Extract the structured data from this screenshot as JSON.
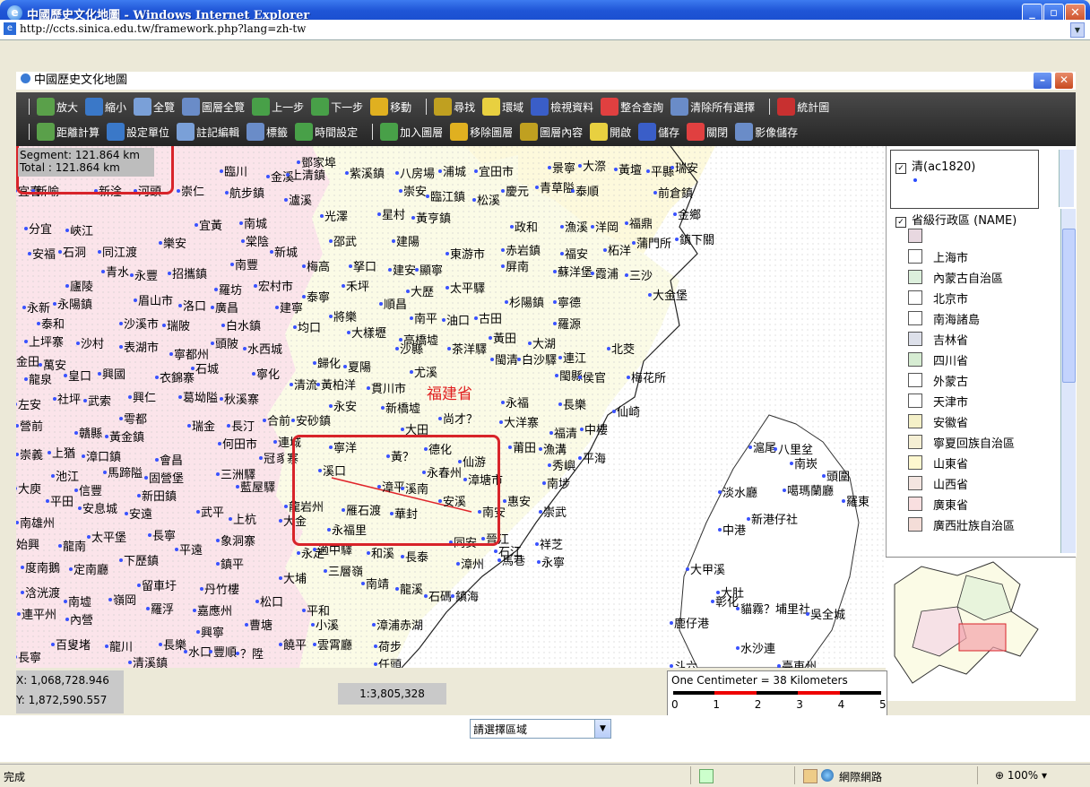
{
  "window": {
    "title": "中國歷史文化地圖 - Windows Internet Explorer",
    "url": "http://ccts.sinica.edu.tw/framework.php?lang=zh-tw",
    "inner_title": "中國歷史文化地圖"
  },
  "toolbar": {
    "row1": [
      "放大",
      "縮小",
      "全覽",
      "圖層全覽",
      "上一步",
      "下一步",
      "移動",
      "尋找",
      "環域",
      "檢視資料",
      "整合查詢",
      "清除所有選擇",
      "統計圖"
    ],
    "row2": [
      "距離計算",
      "設定單位",
      "註記編輯",
      "標籤",
      "時間設定",
      "加入圖層",
      "移除圖層",
      "圖層內容",
      "開啟",
      "儲存",
      "關閉",
      "影像儲存"
    ]
  },
  "measure": {
    "segment": "Segment: 121.864 km",
    "total": "Total : 121.864 km"
  },
  "map": {
    "province_label": "福建省",
    "places": [
      [
        "臨川",
        232,
        18
      ],
      [
        "金溪",
        284,
        24
      ],
      [
        "上清鎮",
        306,
        22
      ],
      [
        "鄧家埠",
        318,
        8
      ],
      [
        "紫溪鎮",
        372,
        20
      ],
      [
        "八房場",
        428,
        20
      ],
      [
        "浦城",
        476,
        18
      ],
      [
        "宜田市",
        516,
        18
      ],
      [
        "景寧",
        598,
        14
      ],
      [
        "大漈",
        632,
        12
      ],
      [
        "黃壇",
        672,
        16
      ],
      [
        "平縣",
        708,
        18
      ],
      [
        "瑞安",
        735,
        14
      ],
      [
        "宜春",
        2,
        40
      ],
      [
        "新喻",
        22,
        40
      ],
      [
        "新淦",
        92,
        40
      ],
      [
        "河頭",
        136,
        40
      ],
      [
        "崇仁",
        184,
        40
      ],
      [
        "航步鎮",
        238,
        42
      ],
      [
        "瀘溪",
        304,
        50
      ],
      [
        "崇安",
        432,
        40
      ],
      [
        "臨江鎮",
        462,
        46
      ],
      [
        "松溪",
        514,
        50
      ],
      [
        "慶元",
        546,
        40
      ],
      [
        "青草隘",
        584,
        36
      ],
      [
        "泰順",
        624,
        40
      ],
      [
        "前倉鎮",
        716,
        42
      ],
      [
        "分宜",
        14,
        82
      ],
      [
        "峽江",
        60,
        84
      ],
      [
        "宜黃",
        204,
        78
      ],
      [
        "南城",
        254,
        76
      ],
      [
        "光澤",
        344,
        68
      ],
      [
        "星村",
        408,
        66
      ],
      [
        "黃亨鎮",
        446,
        70
      ],
      [
        "政和",
        556,
        80
      ],
      [
        "漁溪",
        612,
        80
      ],
      [
        "洋岡",
        646,
        80
      ],
      [
        "福鼎",
        684,
        76
      ],
      [
        "金鄉",
        738,
        66
      ],
      [
        "安福",
        18,
        110
      ],
      [
        "石洞",
        52,
        108
      ],
      [
        "同江渡",
        96,
        108
      ],
      [
        "樂安",
        164,
        98
      ],
      [
        "棠陰",
        256,
        96
      ],
      [
        "新城",
        288,
        108
      ],
      [
        "邵武",
        354,
        96
      ],
      [
        "建陽",
        424,
        96
      ],
      [
        "東游市",
        484,
        110
      ],
      [
        "赤岩鎮",
        546,
        106
      ],
      [
        "福安",
        612,
        110
      ],
      [
        "柘洋",
        660,
        106
      ],
      [
        "蒲門所",
        692,
        98
      ],
      [
        "鎮下關",
        740,
        94
      ],
      [
        "廬陵",
        60,
        146
      ],
      [
        "青水",
        100,
        130
      ],
      [
        "永豐",
        132,
        134
      ],
      [
        "招攜鎮",
        174,
        132
      ],
      [
        "南豐",
        244,
        122
      ],
      [
        "羅坊",
        226,
        150
      ],
      [
        "宏村市",
        270,
        146
      ],
      [
        "梅高",
        324,
        124
      ],
      [
        "拏口",
        376,
        124
      ],
      [
        "禾坪",
        368,
        146
      ],
      [
        "建安",
        420,
        128
      ],
      [
        "顯寧",
        450,
        128
      ],
      [
        "太平驛",
        484,
        148
      ],
      [
        "屏南",
        546,
        124
      ],
      [
        "蘇洋堡",
        604,
        130
      ],
      [
        "霞浦",
        646,
        132
      ],
      [
        "三沙",
        684,
        134
      ],
      [
        "永新",
        12,
        170
      ],
      [
        "永陽鎮",
        46,
        166
      ],
      [
        "眉山市",
        136,
        162
      ],
      [
        "洛口",
        186,
        168
      ],
      [
        "廣昌",
        222,
        170
      ],
      [
        "建寧",
        294,
        170
      ],
      [
        "泰寧",
        324,
        158
      ],
      [
        "順昌",
        410,
        166
      ],
      [
        "大歷",
        440,
        152
      ],
      [
        "杉陽鎮",
        550,
        164
      ],
      [
        "寧德",
        604,
        164
      ],
      [
        "大金堡",
        710,
        156
      ],
      [
        "泰和",
        28,
        188
      ],
      [
        "沙溪市",
        120,
        188
      ],
      [
        "瑞陂",
        168,
        190
      ],
      [
        "將樂",
        354,
        180
      ],
      [
        "白水鎮",
        234,
        190
      ],
      [
        "均口",
        314,
        192
      ],
      [
        "南平",
        444,
        182
      ],
      [
        "油口",
        480,
        184
      ],
      [
        "古田",
        516,
        182
      ],
      [
        "羅源",
        604,
        188
      ],
      [
        "上坪寨",
        14,
        208
      ],
      [
        "沙村",
        72,
        210
      ],
      [
        "表湖市",
        120,
        214
      ],
      [
        "頭陂",
        222,
        210
      ],
      [
        "水西城",
        258,
        216
      ],
      [
        "大樣壢",
        374,
        198
      ],
      [
        "沙縣",
        428,
        216
      ],
      [
        "高橋墟",
        432,
        206
      ],
      [
        "茶洋驛",
        486,
        216
      ],
      [
        "黃田",
        532,
        204
      ],
      [
        "大湖",
        576,
        210
      ],
      [
        "北茭",
        664,
        216
      ],
      [
        "金田",
        0,
        230
      ],
      [
        "萬安",
        30,
        234
      ],
      [
        "寧都州",
        176,
        222
      ],
      [
        "閩清",
        534,
        228
      ],
      [
        "白沙驛",
        564,
        228
      ],
      [
        "連江",
        610,
        226
      ],
      [
        "龍泉",
        14,
        250
      ],
      [
        "皇口",
        58,
        246
      ],
      [
        "興國",
        96,
        244
      ],
      [
        "衣錦寨",
        160,
        248
      ],
      [
        "石城",
        200,
        238
      ],
      [
        "寧化",
        268,
        244
      ],
      [
        "歸化",
        336,
        232
      ],
      [
        "夏陽",
        370,
        236
      ],
      [
        "尤溪",
        444,
        242
      ],
      [
        "閩縣",
        606,
        246
      ],
      [
        "侯官",
        632,
        248
      ],
      [
        "梅花所",
        686,
        248
      ],
      [
        "左安",
        2,
        278
      ],
      [
        "社坪",
        46,
        272
      ],
      [
        "武索",
        80,
        274
      ],
      [
        "興仁",
        130,
        270
      ],
      [
        "葛坳隘",
        186,
        270
      ],
      [
        "秋溪寨",
        232,
        272
      ],
      [
        "清流",
        310,
        256
      ],
      [
        "黃柏洋",
        340,
        256
      ],
      [
        "貫川市",
        396,
        260
      ],
      [
        "永安",
        354,
        280
      ],
      [
        "新橋墟",
        412,
        282
      ],
      [
        "永福",
        546,
        276
      ],
      [
        "長樂",
        610,
        278
      ],
      [
        "仙崎",
        670,
        286
      ],
      [
        "營前",
        4,
        302
      ],
      [
        "雩都",
        120,
        294
      ],
      [
        "瑞金",
        196,
        302
      ],
      [
        "長汀",
        240,
        302
      ],
      [
        "合前",
        280,
        296
      ],
      [
        "安砂鎮",
        312,
        296
      ],
      [
        "大田",
        434,
        306
      ],
      [
        "尚才？",
        476,
        294
      ],
      [
        "大洋寨",
        544,
        298
      ],
      [
        "福清",
        600,
        310
      ],
      [
        "中樓",
        634,
        306
      ],
      [
        "崇義",
        4,
        334
      ],
      [
        "上猶",
        40,
        332
      ],
      [
        "贛縣",
        70,
        310
      ],
      [
        "黃金鎮",
        104,
        314
      ],
      [
        "漳口鎮",
        78,
        336
      ],
      [
        "會昌",
        160,
        340
      ],
      [
        "何田市",
        230,
        322
      ],
      [
        "連城",
        292,
        320
      ],
      [
        "冠豸寨",
        276,
        338
      ],
      [
        "寧洋",
        354,
        326
      ],
      [
        "德化",
        460,
        328
      ],
      [
        "仙游",
        498,
        342
      ],
      [
        "莆田",
        554,
        326
      ],
      [
        "漁溝",
        588,
        328
      ],
      [
        "池江",
        44,
        358
      ],
      [
        "馬蹄隘",
        102,
        354
      ],
      [
        "固營堡",
        148,
        360
      ],
      [
        "三洲驛",
        228,
        356
      ],
      [
        "溪口",
        342,
        352
      ],
      [
        "黃？",
        418,
        336
      ],
      [
        "永春州",
        458,
        354
      ],
      [
        "漳塘市",
        504,
        362
      ],
      [
        "秀嶼",
        598,
        346
      ],
      [
        "平海",
        632,
        338
      ],
      [
        "大庾",
        2,
        372
      ],
      [
        "信豐",
        70,
        374
      ],
      [
        "新田鎮",
        140,
        380
      ],
      [
        "藍屋驛",
        250,
        370
      ],
      [
        "漳平",
        408,
        370
      ],
      [
        "溪南",
        434,
        372
      ],
      [
        "南埗",
        592,
        366
      ],
      [
        "平田",
        38,
        386
      ],
      [
        "安息城",
        74,
        394
      ],
      [
        "安遠",
        126,
        400
      ],
      [
        "龍岩州",
        304,
        392
      ],
      [
        "雁石渡",
        368,
        396
      ],
      [
        "安溪",
        476,
        386
      ],
      [
        "南安",
        520,
        398
      ],
      [
        "惠安",
        548,
        386
      ],
      [
        "崇武",
        588,
        398
      ],
      [
        "南雄州",
        4,
        410
      ],
      [
        "太平堡",
        84,
        426
      ],
      [
        "長寧",
        152,
        424
      ],
      [
        "武平",
        206,
        398
      ],
      [
        "上杭",
        242,
        406
      ],
      [
        "大金",
        298,
        408
      ],
      [
        "永福里",
        352,
        418
      ],
      [
        "華封",
        422,
        400
      ],
      [
        "晉江",
        524,
        428
      ],
      [
        "始興",
        0,
        434
      ],
      [
        "龍南",
        52,
        436
      ],
      [
        "象洞寨",
        228,
        430
      ],
      [
        "平遠",
        182,
        440
      ],
      [
        "永定",
        318,
        444
      ],
      [
        "適中驛",
        336,
        440
      ],
      [
        "和溪",
        396,
        444
      ],
      [
        "長泰",
        434,
        448
      ],
      [
        "同安",
        488,
        432
      ],
      [
        "石江",
        538,
        442
      ],
      [
        "祥芝",
        584,
        434
      ],
      [
        "度南鵝",
        10,
        460
      ],
      [
        "定南廳",
        64,
        462
      ],
      [
        "下歷鎮",
        120,
        452
      ],
      [
        "鎮平",
        228,
        456
      ],
      [
        "三層嶺",
        348,
        464
      ],
      [
        "漳州",
        496,
        456
      ],
      [
        "馬巷",
        542,
        452
      ],
      [
        "永寧",
        586,
        454
      ],
      [
        "浛洸渡",
        10,
        488
      ],
      [
        "留車圩",
        140,
        480
      ],
      [
        "丹竹樓",
        210,
        484
      ],
      [
        "大埔",
        298,
        472
      ],
      [
        "南靖",
        390,
        478
      ],
      [
        "龍溪",
        428,
        484
      ],
      [
        "石碼",
        460,
        492
      ],
      [
        "鎮海",
        490,
        492
      ],
      [
        "南墟",
        58,
        498
      ],
      [
        "嶺岡",
        108,
        496
      ],
      [
        "羅浮",
        150,
        506
      ],
      [
        "嘉應州",
        202,
        508
      ],
      [
        "松口",
        272,
        498
      ],
      [
        "平和",
        324,
        508
      ],
      [
        "連平州",
        6,
        512
      ],
      [
        "內營",
        60,
        518
      ],
      [
        "曹塘",
        260,
        524
      ],
      [
        "小溪",
        334,
        524
      ],
      [
        "漳浦赤湖",
        402,
        524
      ],
      [
        "興寧",
        206,
        532
      ],
      [
        "百叟堵",
        44,
        546
      ],
      [
        "龍川",
        104,
        548
      ],
      [
        "長樂",
        164,
        546
      ],
      [
        "水口",
        192,
        554
      ],
      [
        "豐順",
        220,
        554
      ],
      [
        "？陞",
        250,
        556
      ],
      [
        "饒平",
        298,
        546
      ],
      [
        "雲霄廳",
        336,
        546
      ],
      [
        "荷步",
        404,
        548
      ],
      [
        "長寧",
        2,
        560
      ],
      [
        "清溪鎮",
        130,
        566
      ],
      [
        "任頭",
        404,
        568
      ],
      [
        "滬尾",
        822,
        326
      ],
      [
        "八里坌",
        850,
        328
      ],
      [
        "南崁",
        868,
        344
      ],
      [
        "頭圍",
        904,
        358
      ],
      [
        "噶瑪蘭廳",
        860,
        374
      ],
      [
        "羅東",
        926,
        386
      ],
      [
        "淡水廳",
        788,
        376
      ],
      [
        "新港仔社",
        820,
        406
      ],
      [
        "中港",
        788,
        418
      ],
      [
        "大甲溪",
        752,
        462
      ],
      [
        "大肚",
        786,
        488
      ],
      [
        "彰化",
        780,
        498
      ],
      [
        "貓霧？埔里社",
        808,
        506
      ],
      [
        "吳全城",
        886,
        512
      ],
      [
        "鹿仔港",
        734,
        522
      ],
      [
        "水沙連",
        808,
        550
      ],
      [
        "斗六",
        734,
        570
      ],
      [
        "臺東州",
        854,
        570
      ]
    ]
  },
  "legend": {
    "layer1": "清(ac1820)",
    "layer2": "省級行政區 (NAME)",
    "items": [
      {
        "label": "",
        "color": "#e8d8e0"
      },
      {
        "label": "上海市",
        "color": "#ffffff"
      },
      {
        "label": "內蒙古自治區",
        "color": "#dcefdc"
      },
      {
        "label": "北京市",
        "color": "#ffffff"
      },
      {
        "label": "南海諸島",
        "color": "#ffffff"
      },
      {
        "label": "吉林省",
        "color": "#dde0ea"
      },
      {
        "label": "四川省",
        "color": "#d6ecd2"
      },
      {
        "label": "外蒙古",
        "color": "#ffffff"
      },
      {
        "label": "天津市",
        "color": "#ffffff"
      },
      {
        "label": "安徽省",
        "color": "#f4f0c8"
      },
      {
        "label": "寧夏回族自治區",
        "color": "#f5efd4"
      },
      {
        "label": "山東省",
        "color": "#fdf7cf"
      },
      {
        "label": "山西省",
        "color": "#f3e5e0"
      },
      {
        "label": "廣東省",
        "color": "#f9dfe0"
      },
      {
        "label": "廣西壯族自治區",
        "color": "#f4ddd8"
      }
    ]
  },
  "coords": {
    "x": "X: 1,068,728.946",
    "y": "Y: 1,872,590.557"
  },
  "scale": {
    "ratio": "1:3,805,328",
    "caption": "One Centimeter = 38 Kilometers",
    "ticks": [
      "0",
      "1",
      "2",
      "3",
      "4",
      "5"
    ]
  },
  "region_select": {
    "value": "請選擇區域"
  },
  "statusbar": {
    "status": "完成",
    "zone": "網際網路",
    "zoom": "100%"
  },
  "colors": {
    "titlebar": "#1f55d6",
    "highlight": "#d8242a",
    "jiangxi": "#fbe3e8",
    "fujian": "#fafbe4",
    "zhejiang": "#fdf8d8",
    "taiwan": "#ffffff"
  }
}
